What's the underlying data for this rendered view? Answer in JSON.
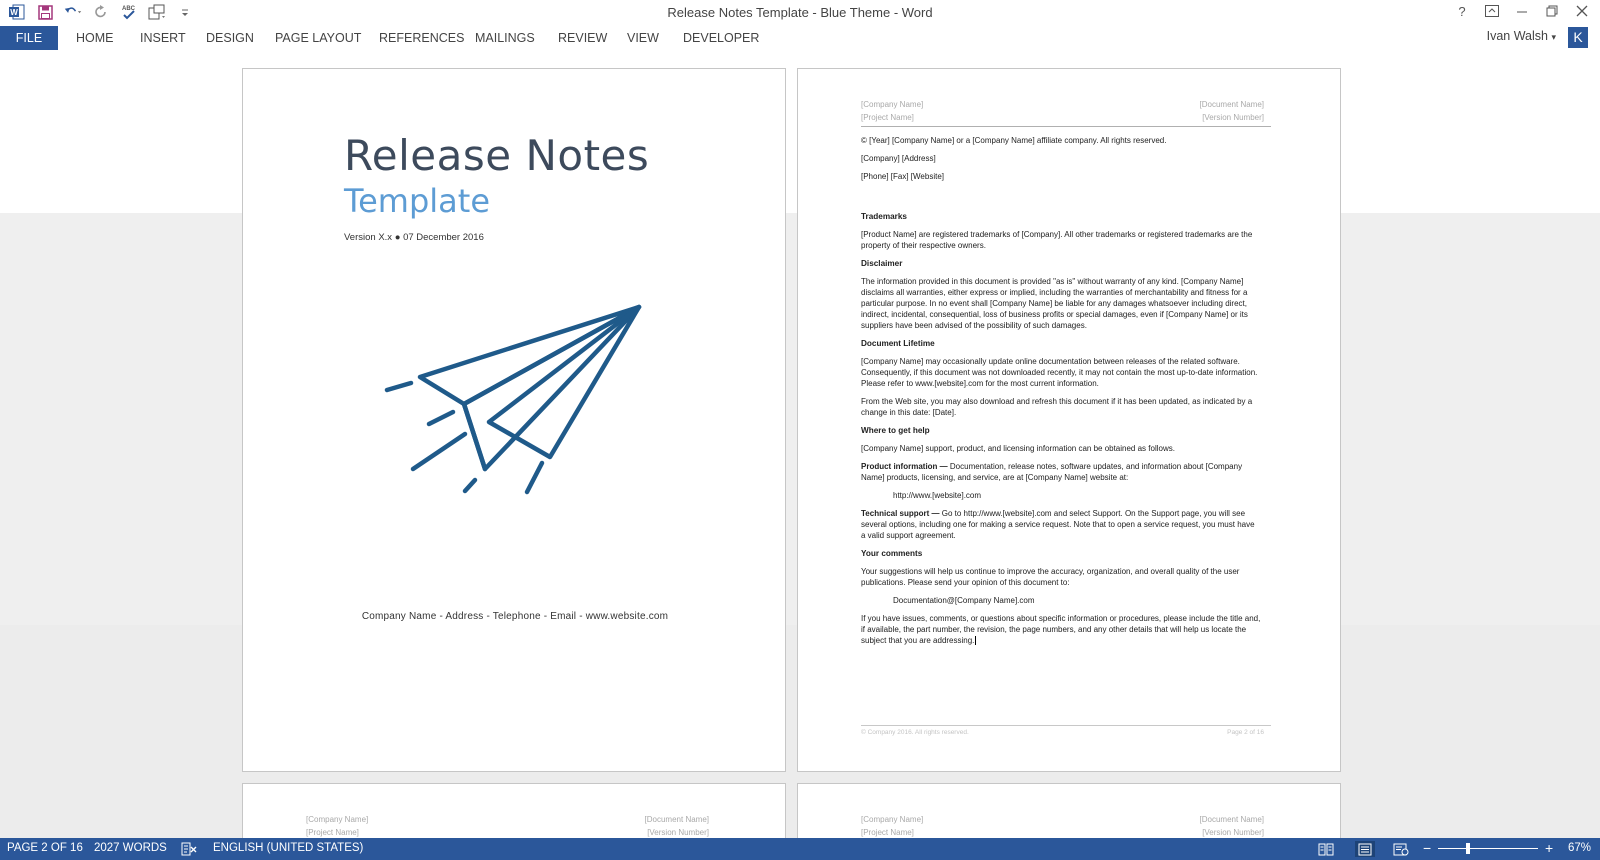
{
  "window": {
    "title": "Release Notes Template - Blue Theme - Word",
    "user": "Ivan Walsh",
    "avatar_letter": "K"
  },
  "quick_access": {
    "icons": [
      "word-logo-icon",
      "save-icon",
      "undo-icon",
      "redo-icon",
      "spelling-icon",
      "touch-mode-icon",
      "customize-icon"
    ]
  },
  "window_controls": [
    "help-icon",
    "ribbon-display-icon",
    "minimize-icon",
    "restore-icon",
    "close-icon"
  ],
  "ribbon": {
    "tabs": [
      "FILE",
      "HOME",
      "INSERT",
      "DESIGN",
      "PAGE LAYOUT",
      "REFERENCES",
      "MAILINGS",
      "REVIEW",
      "VIEW",
      "DEVELOPER"
    ]
  },
  "cover": {
    "title": "Release Notes",
    "subtitle": "Template",
    "version": "Version X.x ● 07 December 2016",
    "footer": "Company Name - Address - Telephone - Email - www.website.com",
    "plane_color": "#1f5a8a"
  },
  "page_header": {
    "company": "[Company Name]",
    "project": "[Project Name]",
    "document": "[Document Name]",
    "version": "[Version Number]"
  },
  "page2": {
    "copyright": "© [Year] [Company Name] or a [Company Name] affiliate company. All rights reserved.",
    "address": "[Company] [Address]",
    "contact": "[Phone] [Fax] [Website]",
    "trademarks_h": "Trademarks",
    "trademarks": "[Product Name] are registered trademarks of [Company]. All other trademarks or registered trademarks are the property of their respective owners.",
    "disclaimer_h": "Disclaimer",
    "disclaimer": "The information provided in this document is provided \"as is\" without warranty of any kind. [Company Name] disclaims all warranties, either express or implied, including the warranties of merchantability and fitness for a particular purpose. In no event shall [Company Name] be liable for any damages whatsoever including direct, indirect, incidental, consequential, loss of business profits or special damages, even if [Company Name] or its suppliers have been advised of the possibility of such damages.",
    "lifetime_h": "Document Lifetime",
    "lifetime1": "[Company Name] may occasionally update online documentation between releases of the related software. Consequently, if this document was not downloaded recently, it may not contain the most up-to-date information. Please refer to www.[website].com for the most current information.",
    "lifetime2": "From the Web site, you may also download and refresh this document if it has been updated, as indicated by a change in this date: [Date].",
    "help_h": "Where to get help",
    "help": "[Company Name] support, product, and licensing information can be obtained as follows.",
    "prodinfo_label": "Product information —",
    "prodinfo": " Documentation, release notes, software updates, and information about [Company Name] products, licensing, and service, are at [Company Name] website at:",
    "prodinfo_url": "http://www.[website].com",
    "tech_label": "Technical support —",
    "tech": " Go to http://www.[website].com and select Support. On the Support page, you will see several options, including one for making a service request. Note that to open a service request, you must have a valid support agreement.",
    "comments_h": "Your comments",
    "comments": "Your suggestions will help us continue to improve the accuracy, organization, and overall quality of the user publications. Please send your opinion of this document to:",
    "comments_email": "Documentation@[Company Name].com",
    "comments2": "If you have issues, comments, or questions about specific information or procedures, please include the title and, if available, the part number, the revision, the page numbers, and any other details that will help us locate the subject that you are addressing.",
    "footer_left": "© Company 2016. All rights reserved.",
    "footer_right": "Page 2 of 16"
  },
  "status": {
    "page": "PAGE 2 OF 16",
    "words": "2027 WORDS",
    "language": "ENGLISH (UNITED STATES)",
    "zoom": "67%",
    "zoom_level": 0.3
  },
  "colors": {
    "accent": "#2b579a",
    "title_dark": "#3d4a5c",
    "title_blue": "#5d9cd4"
  }
}
